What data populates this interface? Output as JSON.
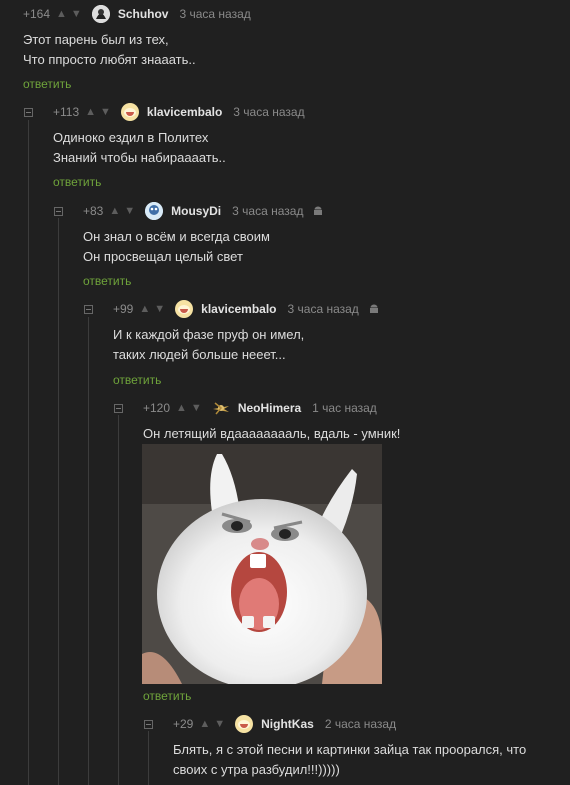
{
  "comments": [
    {
      "rating": "+164",
      "username": "Schuhov",
      "time": "3 часа назад",
      "lines": [
        "Этот парень был из тех,",
        "Что ппросто любят знааать.."
      ],
      "reply": "ответить"
    },
    {
      "rating": "+113",
      "username": "klavicembalo",
      "time": "3 часа назад",
      "lines": [
        "Одиноко ездил в Политех",
        "Знаний чтобы набираааать.."
      ],
      "reply": "ответить"
    },
    {
      "rating": "+83",
      "username": "MousyDi",
      "time": "3 часа назад",
      "lines": [
        "Он знал о всём и всегда своим",
        "Он просвещал целый свет"
      ],
      "reply": "ответить"
    },
    {
      "rating": "+99",
      "username": "klavicembalo",
      "time": "3 часа назад",
      "lines": [
        "И к каждой фазе пруф он имел,",
        "таких людей больше нееет..."
      ],
      "reply": "ответить"
    },
    {
      "rating": "+120",
      "username": "NeoHimera",
      "time": "1 час назад",
      "lines": [
        "Он летящий вдааааааааль, вдаль - умник!"
      ],
      "reply": "ответить"
    },
    {
      "rating": "+29",
      "username": "NightKas",
      "time": "2 часа назад",
      "lines": [
        "Блять, я с этой песни и картинки зайца так проорался, что",
        "своих с утра разбудил!!!)))))"
      ]
    }
  ],
  "icons": {
    "upvote": "upvote-icon",
    "downvote": "downvote-icon",
    "android": "android-icon",
    "collapse": "collapse-icon"
  },
  "colors": {
    "background": "#202020",
    "reply": "#6fa43b",
    "text": "#dcdcdc"
  }
}
